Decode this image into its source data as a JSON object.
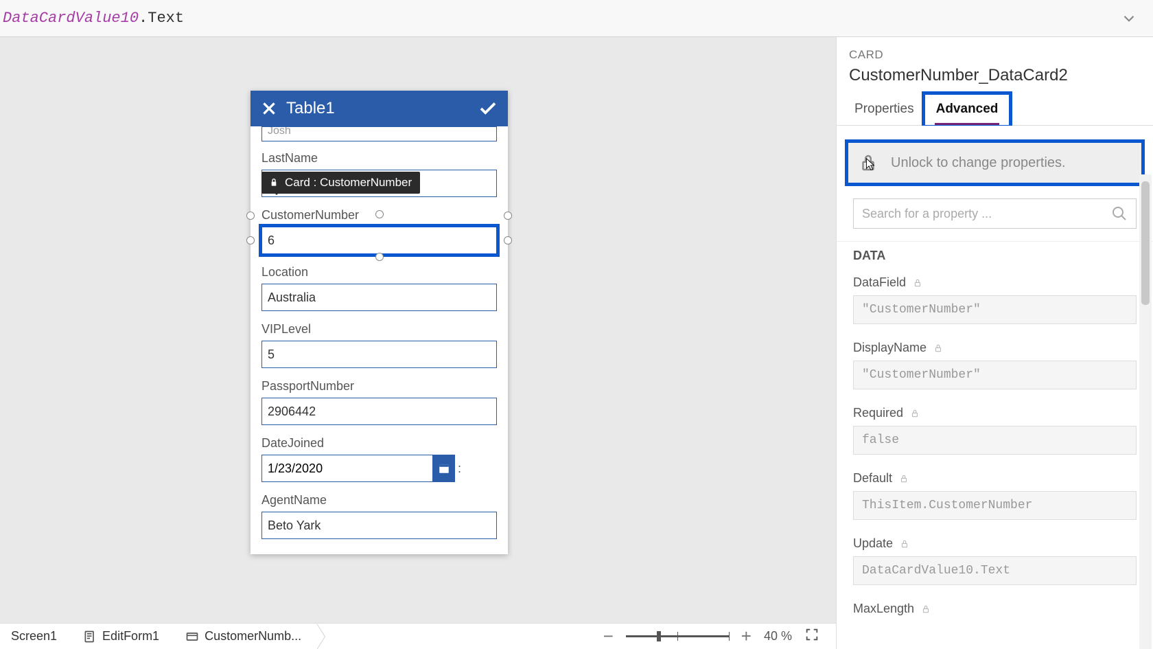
{
  "formula": {
    "prefix": "DataCardValue10",
    "suffix": ".Text"
  },
  "canvas": {
    "formTitle": "Table1",
    "partialFieldTopValue": "Josh",
    "tooltip": "Card : CustomerNumber",
    "fields": {
      "lastName": {
        "label": "LastName",
        "value": ""
      },
      "customerNumber": {
        "label": "CustomerNumber",
        "value": "6"
      },
      "location": {
        "label": "Location",
        "value": "Australia"
      },
      "vipLevel": {
        "label": "VIPLevel",
        "value": "5"
      },
      "passportNumber": {
        "label": "PassportNumber",
        "value": "2906442"
      },
      "dateJoined": {
        "label": "DateJoined",
        "value": "1/23/2020"
      },
      "agentName": {
        "label": "AgentName",
        "value": "Beto Yark"
      }
    }
  },
  "panel": {
    "cardLabel": "CARD",
    "cardName": "CustomerNumber_DataCard2",
    "tabs": {
      "properties": "Properties",
      "advanced": "Advanced"
    },
    "unlockText": "Unlock to change properties.",
    "searchPlaceholder": "Search for a property ...",
    "sections": {
      "data": "DATA"
    },
    "props": {
      "dataField": {
        "name": "DataField",
        "value": "\"CustomerNumber\""
      },
      "displayName": {
        "name": "DisplayName",
        "value": "\"CustomerNumber\""
      },
      "required": {
        "name": "Required",
        "value": "false"
      },
      "default": {
        "name": "Default",
        "value": "ThisItem.CustomerNumber"
      },
      "update": {
        "name": "Update",
        "value": "DataCardValue10.Text"
      },
      "maxLength": {
        "name": "MaxLength"
      }
    }
  },
  "footer": {
    "crumbs": {
      "screen": "Screen1",
      "form": "EditForm1",
      "card": "CustomerNumb..."
    },
    "zoom": {
      "pct": "40",
      "unit": "%"
    }
  }
}
